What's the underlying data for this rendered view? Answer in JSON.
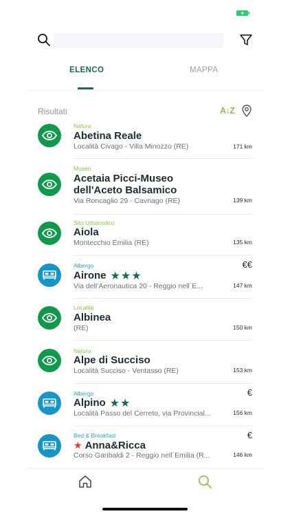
{
  "search": {
    "placeholder": ""
  },
  "tabs": [
    {
      "label": "ELENCO",
      "active": true
    },
    {
      "label": "MAPPA",
      "active": false
    }
  ],
  "results": {
    "label": "Risultati",
    "sort_label": "A↓Z"
  },
  "items": [
    {
      "category": "Natura",
      "title": "Abetina Reale",
      "address": "Località Civago - Villa Minozzo (RE)",
      "distance": "171 km",
      "icon": "eye-icon",
      "color": "green"
    },
    {
      "category": "Museo",
      "title_line1": "Acetaia Picci-Museo",
      "title_line2": "dell'Aceto Balsamico",
      "address": "Via Roncaglio 29 - Cavriago (RE)",
      "distance": "139 km",
      "icon": "eye-icon",
      "color": "green"
    },
    {
      "category": "Sito Urbanistico",
      "title": "Aiola",
      "address": "Montecchio Emilia (RE)",
      "distance": "135 km",
      "icon": "eye-icon",
      "color": "green"
    },
    {
      "category": "Albergo",
      "title": "Airone",
      "stars": "★★★",
      "price": "€€",
      "address": "Via dell'Aeronautica 20 - Reggio nell´E...",
      "distance": "147 km",
      "icon": "bed-icon",
      "color": "blue"
    },
    {
      "category": "Località",
      "title": "Albinea",
      "address": "(RE)",
      "distance": "150 km",
      "icon": "eye-icon",
      "color": "green"
    },
    {
      "category": "Natura",
      "title": "Alpe di Succiso",
      "address": "Località Succiso - Ventasso (RE)",
      "distance": "153 km",
      "icon": "eye-icon",
      "color": "green"
    },
    {
      "category": "Albergo",
      "title": "Alpino",
      "stars": "★★",
      "price": "€",
      "address": "Località Passo del Cerreto, via Provincial...",
      "distance": "156 km",
      "icon": "bed-icon",
      "color": "blue"
    },
    {
      "category": "Bed & Breakfast",
      "title": "Anna&Ricca",
      "star": "★",
      "price": "€",
      "address": "Corso Garibaldi 2 - Reggio nell´Emilia (R...",
      "distance": "146 km",
      "icon": "bed-icon",
      "color": "blue"
    }
  ],
  "colors": {
    "brand_green": "#1b6b47",
    "badge_green": "#0f9a4b",
    "badge_blue": "#1696c8",
    "accent_lime": "#8bc34a"
  }
}
